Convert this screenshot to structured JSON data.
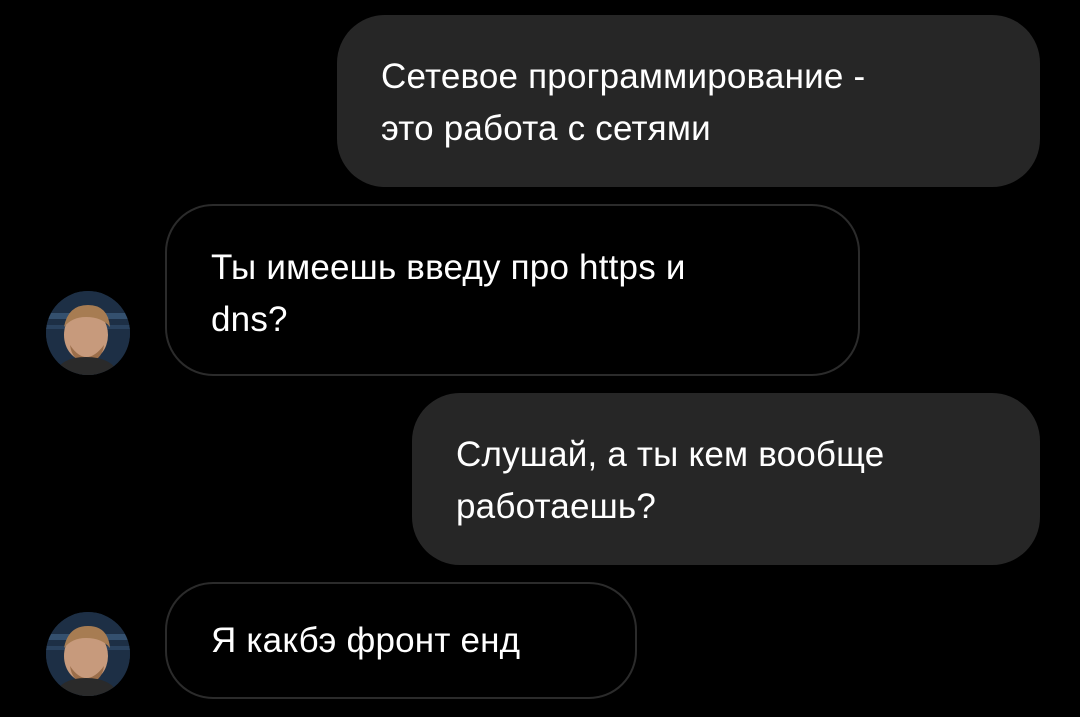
{
  "conversation": {
    "messages": [
      {
        "direction": "outgoing",
        "text": "Сетевое программирование -\nэто работа с сетями"
      },
      {
        "direction": "incoming",
        "text": "Ты имеешь введу про https и\ndns?"
      },
      {
        "direction": "outgoing",
        "text": "Слушай, а ты кем вообще\nработаешь?"
      },
      {
        "direction": "incoming",
        "text": "Я какбэ фронт енд"
      }
    ]
  },
  "colors": {
    "background": "#000000",
    "outgoing_bubble": "#262626",
    "incoming_border": "#2b2b2b",
    "text": "#ffffff"
  }
}
